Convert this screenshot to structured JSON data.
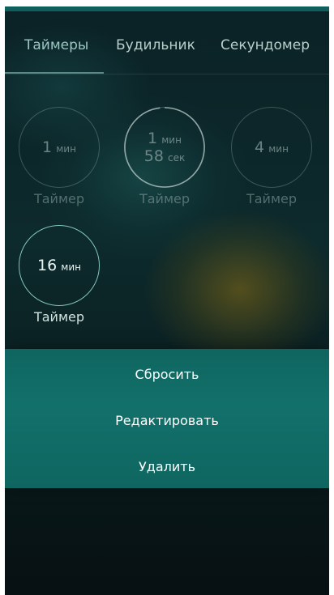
{
  "tabs": [
    {
      "label": "Таймеры"
    },
    {
      "label": "Будильник"
    },
    {
      "label": "Секундомер"
    }
  ],
  "timers": [
    {
      "line1_value": "1",
      "line1_unit": "мин",
      "label": "Таймер"
    },
    {
      "line1_value": "1",
      "line1_unit": "мин",
      "line2_value": "58",
      "line2_unit": "сек",
      "label": "Таймер",
      "progress": 0.98
    },
    {
      "line1_value": "4",
      "line1_unit": "мин",
      "label": "Таймер"
    },
    {
      "line1_value": "16",
      "line1_unit": "мин",
      "label": "Таймер"
    }
  ],
  "menu": {
    "reset": "Сбросить",
    "edit": "Редактировать",
    "delete": "Удалить"
  },
  "colors": {
    "background": "#0b2226",
    "menu_background": "#12706a",
    "accent_ring": "#96e1d7",
    "tab_text": "#b7cfcb"
  }
}
